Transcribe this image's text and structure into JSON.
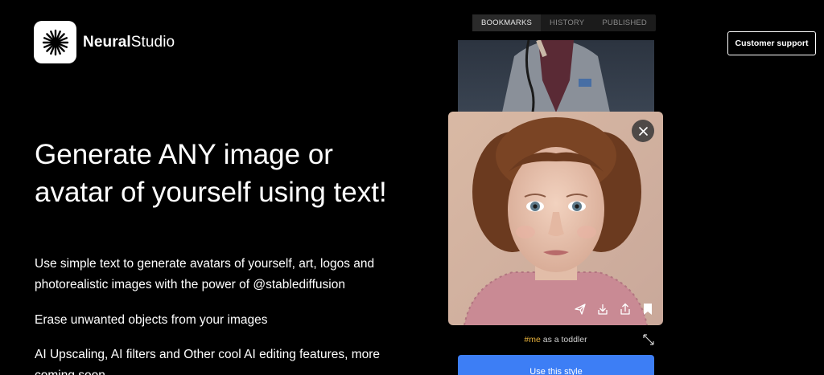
{
  "brand": {
    "name_bold": "Neural",
    "name_light": "Studio",
    "logo_icon": "asterisk-burst-icon"
  },
  "header": {
    "support_label": "Customer support"
  },
  "tabs": [
    {
      "label": "BOOKMARKS",
      "active": true
    },
    {
      "label": "HISTORY",
      "active": false
    },
    {
      "label": "PUBLISHED",
      "active": false
    }
  ],
  "hero": {
    "title": "Generate ANY image or avatar of yourself using text!",
    "features": [
      "Use simple text to generate avatars of yourself, art, logos and photorealistic images with the power of @stablediffusion",
      "Erase unwanted objects from your images",
      "AI Upscaling, AI filters and Other cool AI editing features, more coming soon"
    ]
  },
  "preview": {
    "caption_tag": "#me",
    "caption_text": " as a toddler",
    "use_style_label": "Use this style",
    "actions": [
      "send-icon",
      "download-icon",
      "share-icon",
      "bookmark-icon"
    ]
  },
  "colors": {
    "accent": "#3d7ef5",
    "tag": "#e8b23c",
    "background": "#000000"
  }
}
